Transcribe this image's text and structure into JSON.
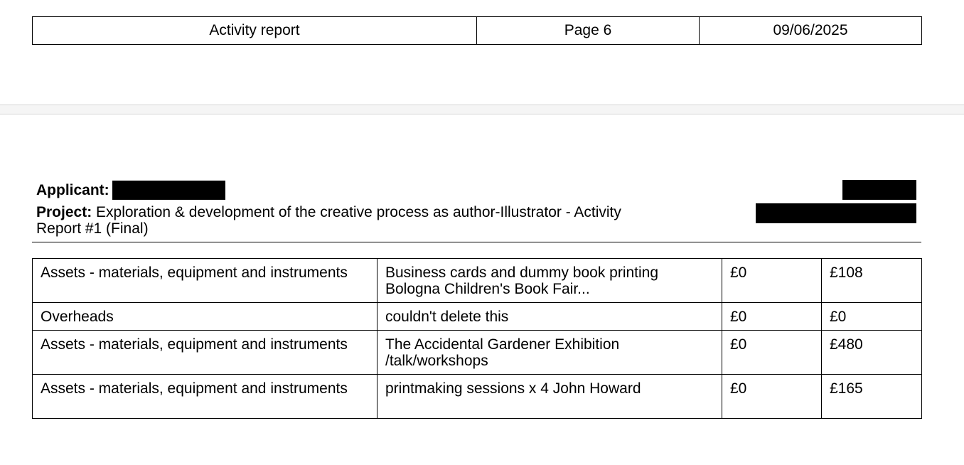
{
  "header": {
    "title": "Activity report",
    "page": "Page 6",
    "date": "09/06/2025"
  },
  "info": {
    "applicant_label": "Applicant:",
    "project_label": "Project:",
    "project_text": "Exploration & development of the creative process as author-Illustrator - Activity Report #1 (Final)"
  },
  "rows": [
    {
      "category": "Assets - materials, equipment and instruments",
      "description": "Business cards and dummy book printing Bologna Children's Book Fair...",
      "amount_1": "£0",
      "amount_2": "£108"
    },
    {
      "category": "Overheads",
      "description": "couldn't delete this",
      "amount_1": "£0",
      "amount_2": "£0"
    },
    {
      "category": "Assets - materials, equipment and instruments",
      "description": "The Accidental Gardener Exhibition /talk/workshops",
      "amount_1": "£0",
      "amount_2": "£480"
    },
    {
      "category": "Assets - materials, equipment and instruments",
      "description": "printmaking sessions x 4 John Howard",
      "amount_1": "£0",
      "amount_2": "£165"
    }
  ]
}
